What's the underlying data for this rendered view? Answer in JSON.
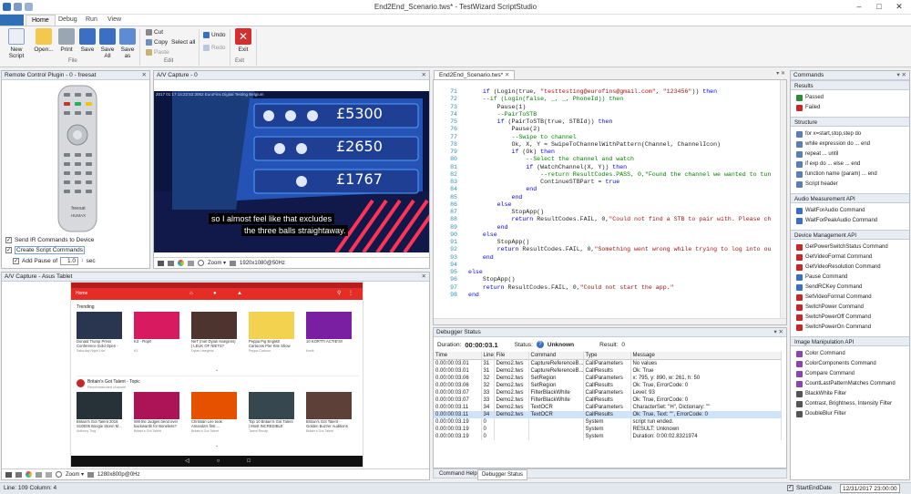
{
  "titlebar": {
    "title": "End2End_Scenario.tws* - TestWizard ScriptStudio"
  },
  "ribbon_tabs": [
    "Home",
    "Debug",
    "Run",
    "View"
  ],
  "ribbon": {
    "new_script": "New Script",
    "open": "Open...",
    "print": "Print",
    "save": "Save",
    "save_all": "Save All",
    "save_as": "Save as",
    "file_group": "File",
    "cut": "Cut",
    "copy": "Copy",
    "select_all": "Select all",
    "paste": "Paste",
    "edit_group": "Edit",
    "undo": "Undo",
    "redo": "Redo",
    "exit": "Exit",
    "exit_group": "Exit"
  },
  "remote_panel": {
    "title": "Remote Control Plugin - 0 - freesat",
    "brand1": "freesat",
    "brand2": "HUMAX",
    "send_ir": "Send IR Commands to Device",
    "create_script": "Create Script Commands",
    "add_pause": "Add Pause of",
    "pause_value": "1.0",
    "pause_unit": "sec"
  },
  "av_capture0": {
    "title": "A/V Capture - 0",
    "overlay": "2017 01 17  14:22:52:3062   EuroFins Digital Testing Belgium",
    "amount1": "£5300",
    "amount2": "£2650",
    "amount3": "£1767",
    "subtitle1": "so I almost feel like that excludes",
    "subtitle2": "the three balls straightaway.",
    "zoom": "Zoom",
    "resolution": "1920x1080@50Hz"
  },
  "av_capture_tablet": {
    "title": "A/V Capture - Asus Tablet",
    "yt_home": "Home",
    "trending": "Trending",
    "trending_videos": [
      {
        "title": "Donald Trump Press Conference Gold Open - SNL",
        "channel": "Saturday Night Live",
        "meta": ""
      },
      {
        "title": "K3 - Flop!!",
        "channel": "K3",
        "meta": ""
      },
      {
        "title": "NeT (met Dylan Haegens) | LEUK OF NIETS?",
        "channel": "Dylan Haegens",
        "meta": ""
      },
      {
        "title": "Peppa Pig English Cartoons Pier Kite Show",
        "channel": "Peppa Cartoon",
        "meta": ""
      },
      {
        "title": "10 KORTTI ACTIE'S!!",
        "channel": "Kortti",
        "meta": ""
      }
    ],
    "section2_title": "Britain's Got Talent - Topic",
    "section2_sub": "Recommended channel",
    "bgt_videos": [
      {
        "title": "Britain's Got Talent 2016 S10E05 Boogie Storm M...",
        "channel": "Anthony Ting",
        "meta": ""
      },
      {
        "title": "Will the Judges bend over backwards for Boneless?",
        "channel": "Britain's Got Talent",
        "meta": ""
      },
      {
        "title": "Christian Lee took Amanda's first ...",
        "channel": "Britain's Got Talent",
        "meta": ""
      },
      {
        "title": "Top 10 Britain's Got Talent | Most INCREDIBLE",
        "channel": "Talent Recap",
        "meta": ""
      },
      {
        "title": "Britain's Got Talent - Golden Buzzer Auditions",
        "channel": "Britain's Got Talent",
        "meta": ""
      }
    ],
    "zoom": "Zoom",
    "resolution": "1280x800p@0Hz"
  },
  "editor": {
    "tab": "End2End_Scenario.tws*",
    "lines": [
      {
        "n": "71",
        "t": [
          [
            "    ",
            ""
          ],
          [
            "if",
            "kw"
          ],
          [
            " (Login(true, ",
            ""
          ],
          [
            "\"testtesting@eurofins@gmail.com\"",
            "str"
          ],
          [
            ", ",
            ""
          ],
          [
            "\"123456\"",
            "str"
          ],
          [
            ")) ",
            ""
          ],
          [
            "then",
            "kw"
          ]
        ]
      },
      {
        "n": "72",
        "t": [
          [
            "    --if (Login(false, _, _, PhoneId)) then",
            "cm"
          ]
        ]
      },
      {
        "n": "73",
        "t": [
          [
            "        Pause(1)",
            ""
          ]
        ]
      },
      {
        "n": "74",
        "t": [
          [
            "        --PairToSTB",
            "cm"
          ]
        ]
      },
      {
        "n": "75",
        "t": [
          [
            "        ",
            ""
          ],
          [
            "if",
            "kw"
          ],
          [
            " (PairToSTB(true, STBId)) ",
            ""
          ],
          [
            "then",
            "kw"
          ]
        ]
      },
      {
        "n": "76",
        "t": [
          [
            "            Pause(2)",
            ""
          ]
        ]
      },
      {
        "n": "77",
        "t": [
          [
            "            --Swipe to channel",
            "cm"
          ]
        ]
      },
      {
        "n": "78",
        "t": [
          [
            "            Ok, X, Y = SwipeToChannelWithPattern(Channel, ChannelIcon)",
            ""
          ]
        ]
      },
      {
        "n": "79",
        "t": [
          [
            "            ",
            ""
          ],
          [
            "if",
            "kw"
          ],
          [
            " (Ok) ",
            ""
          ],
          [
            "then",
            "kw"
          ]
        ]
      },
      {
        "n": "80",
        "t": [
          [
            "                --Select the channel and watch",
            "cm"
          ]
        ]
      },
      {
        "n": "81",
        "t": [
          [
            "                ",
            ""
          ],
          [
            "if",
            "kw"
          ],
          [
            " (WatchChannel(X, Y)) ",
            ""
          ],
          [
            "then",
            "kw"
          ]
        ]
      },
      {
        "n": "82",
        "t": [
          [
            "                    --return ResultCodes.PASS, 0,\"Found the channel we wanted to tun",
            "cm"
          ]
        ]
      },
      {
        "n": "83",
        "t": [
          [
            "                    ContinueSTBPart = ",
            ""
          ],
          [
            "true",
            "kw"
          ]
        ]
      },
      {
        "n": "84",
        "t": [
          [
            "                ",
            ""
          ],
          [
            "end",
            "kw"
          ]
        ]
      },
      {
        "n": "85",
        "t": [
          [
            "            ",
            ""
          ],
          [
            "end",
            "kw"
          ]
        ]
      },
      {
        "n": "86",
        "t": [
          [
            "        ",
            ""
          ],
          [
            "else",
            "kw"
          ]
        ]
      },
      {
        "n": "87",
        "t": [
          [
            "            StopApp()",
            ""
          ]
        ]
      },
      {
        "n": "88",
        "t": [
          [
            "            ",
            ""
          ],
          [
            "return",
            "kw"
          ],
          [
            " ResultCodes.FAIL, 0,",
            ""
          ],
          [
            "\"Could not find a STB to pair with. Please ch",
            "str"
          ]
        ]
      },
      {
        "n": "89",
        "t": [
          [
            "        ",
            ""
          ],
          [
            "end",
            "kw"
          ]
        ]
      },
      {
        "n": "90",
        "t": [
          [
            "    ",
            ""
          ],
          [
            "else",
            "kw"
          ]
        ]
      },
      {
        "n": "91",
        "t": [
          [
            "        StopApp()",
            ""
          ]
        ]
      },
      {
        "n": "92",
        "t": [
          [
            "        ",
            ""
          ],
          [
            "return",
            "kw"
          ],
          [
            " ResultCodes.FAIL, 0,",
            ""
          ],
          [
            "\"Something went wrong while trying to log into ou",
            "str"
          ]
        ]
      },
      {
        "n": "93",
        "t": [
          [
            "    ",
            ""
          ],
          [
            "end",
            "kw"
          ]
        ]
      },
      {
        "n": "94",
        "t": [
          [
            "",
            ""
          ]
        ]
      },
      {
        "n": "95",
        "t": [
          [
            "else",
            "kw"
          ]
        ]
      },
      {
        "n": "96",
        "t": [
          [
            "    StopApp()",
            ""
          ]
        ]
      },
      {
        "n": "97",
        "t": [
          [
            "    ",
            ""
          ],
          [
            "return",
            "kw"
          ],
          [
            " ResultCodes.FAIL, 0,",
            ""
          ],
          [
            "\"Could not start the app.\"",
            "str"
          ]
        ]
      },
      {
        "n": "98",
        "t": [
          [
            "end",
            "kw"
          ]
        ]
      }
    ]
  },
  "debugger": {
    "title": "Debugger Status",
    "duration_label": "Duration:",
    "duration": "00:00:03.1",
    "status_label": "Status:",
    "status": "Unknown",
    "result_label": "Result:",
    "result": "0",
    "columns": [
      "Time",
      "Line",
      "File",
      "Command",
      "Type",
      "Message"
    ],
    "rows": [
      [
        "0.00:00:03.01",
        "31",
        "Demo2.tws",
        "CaptureReferenceB...",
        "CallParameters",
        "No values"
      ],
      [
        "0.00:00:03.01",
        "31",
        "Demo2.tws",
        "CaptureReferenceB...",
        "CallResults",
        "Ok: True"
      ],
      [
        "0.00:00:03.06",
        "32",
        "Demo2.tws",
        "SetRegion",
        "CallParameters",
        "x: 795, y: 890, w: 261, h: 50"
      ],
      [
        "0.00:00:03.06",
        "32",
        "Demo2.tws",
        "SetRegion",
        "CallResults",
        "Ok: True, ErrorCode: 0"
      ],
      [
        "0.00:00:03.07",
        "33",
        "Demo2.tws",
        "FilterBlackWhite",
        "CallParameters",
        "Level: 93"
      ],
      [
        "0.00:00:03.07",
        "33",
        "Demo2.tws",
        "FilterBlackWhite",
        "CallResults",
        "Ok: True, ErrorCode: 0"
      ],
      [
        "0.00:00:03.11",
        "34",
        "Demo2.tws",
        "TextOCR",
        "CallParameters",
        "CharacterSet: \"H\", Dictionary: \"\""
      ],
      [
        "0.00:00:03.11",
        "34",
        "Demo2.tws",
        "TextOCR",
        "CallResults",
        "Ok: True, Text: \"\", ErrorCode: 0"
      ],
      [
        "0.00:00:03.19",
        "0",
        "",
        "",
        "System",
        "script run ended."
      ],
      [
        "0.00:00:03.19",
        "0",
        "",
        "",
        "System",
        "RESULT: Unknown"
      ],
      [
        "0.00:00:03.19",
        "0",
        "",
        "",
        "System",
        "Duration: 0:00:02.8321974"
      ]
    ],
    "tab1": "Command Help",
    "tab2": "Debugger Status"
  },
  "commands": {
    "title": "Commands",
    "sections": [
      {
        "name": "Results",
        "items": [
          {
            "label": "Passed",
            "color": "#2e8b3a"
          },
          {
            "label": "Failed",
            "color": "#c62828"
          }
        ]
      },
      {
        "name": "Structure",
        "items": [
          {
            "label": "for x=start,stop,step do",
            "color": "#5a7fb5"
          },
          {
            "label": "while expression do ... end",
            "color": "#5a7fb5"
          },
          {
            "label": "repeat ... until",
            "color": "#5a7fb5"
          },
          {
            "label": "if exp do ... else ... end",
            "color": "#5a7fb5"
          },
          {
            "label": "function name (param) ... end",
            "color": "#5a7fb5"
          },
          {
            "label": "Script header",
            "color": "#5a7fb5"
          }
        ]
      },
      {
        "name": "Audio Measurement API",
        "items": [
          {
            "label": "WaitForAudio Command",
            "color": "#3b6fc4"
          },
          {
            "label": "WaitForPeakAudio Command",
            "color": "#3b6fc4"
          }
        ]
      },
      {
        "name": "Device Management API",
        "items": [
          {
            "label": "GetPowerSwitchStatus Command",
            "color": "#c62828"
          },
          {
            "label": "GetVideoFormat Command",
            "color": "#c62828"
          },
          {
            "label": "GetVideoResolution Command",
            "color": "#c62828"
          },
          {
            "label": "Pause Command",
            "color": "#3b6fc4"
          },
          {
            "label": "SendRCKey Command",
            "color": "#3b6fc4"
          },
          {
            "label": "SetVideoFormat Command",
            "color": "#c62828"
          },
          {
            "label": "SwitchPower Command",
            "color": "#c62828"
          },
          {
            "label": "SwitchPowerOff Command",
            "color": "#c62828"
          },
          {
            "label": "SwitchPowerOn Command",
            "color": "#c62828"
          }
        ]
      },
      {
        "name": "Image Manipulation API",
        "items": [
          {
            "label": "Color Command",
            "color": "#8e44ad"
          },
          {
            "label": "ColorComponents Command",
            "color": "#8e44ad"
          },
          {
            "label": "Compare Command",
            "color": "#8e44ad"
          },
          {
            "label": "CountLastPatternMatches Command",
            "color": "#8e44ad"
          },
          {
            "label": "BlackWhite Filter",
            "color": "#555555"
          },
          {
            "label": "Contrast, Brightness, Intensity Filter",
            "color": "#555555"
          },
          {
            "label": "DoubleBlur Filter",
            "color": "#555555"
          }
        ]
      }
    ]
  },
  "statusbar": {
    "position": "Line: 109  Column: 4",
    "end_date_label": "StartEndDate",
    "datetime": "12/31/2017 23:00:00"
  }
}
